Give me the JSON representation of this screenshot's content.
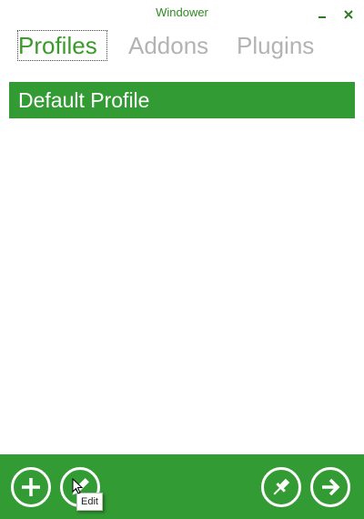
{
  "window": {
    "title": "Windower",
    "minimize_icon": "minimize-icon",
    "close_icon": "close-icon"
  },
  "tabs": [
    {
      "label": "Profiles",
      "active": true
    },
    {
      "label": "Addons",
      "active": false
    },
    {
      "label": "Plugins",
      "active": false
    }
  ],
  "profiles": [
    {
      "label": "Default Profile",
      "selected": true
    }
  ],
  "toolbar": {
    "add_icon": "plus-icon",
    "edit_icon": "pencil-icon",
    "pin_icon": "pin-icon",
    "launch_icon": "arrow-right-icon",
    "tooltip": "Edit"
  },
  "colors": {
    "accent": "#339b33",
    "title_text": "#2f8a22",
    "active_tab": "#3a9b2a",
    "inactive_tab": "#b3b3b3"
  }
}
